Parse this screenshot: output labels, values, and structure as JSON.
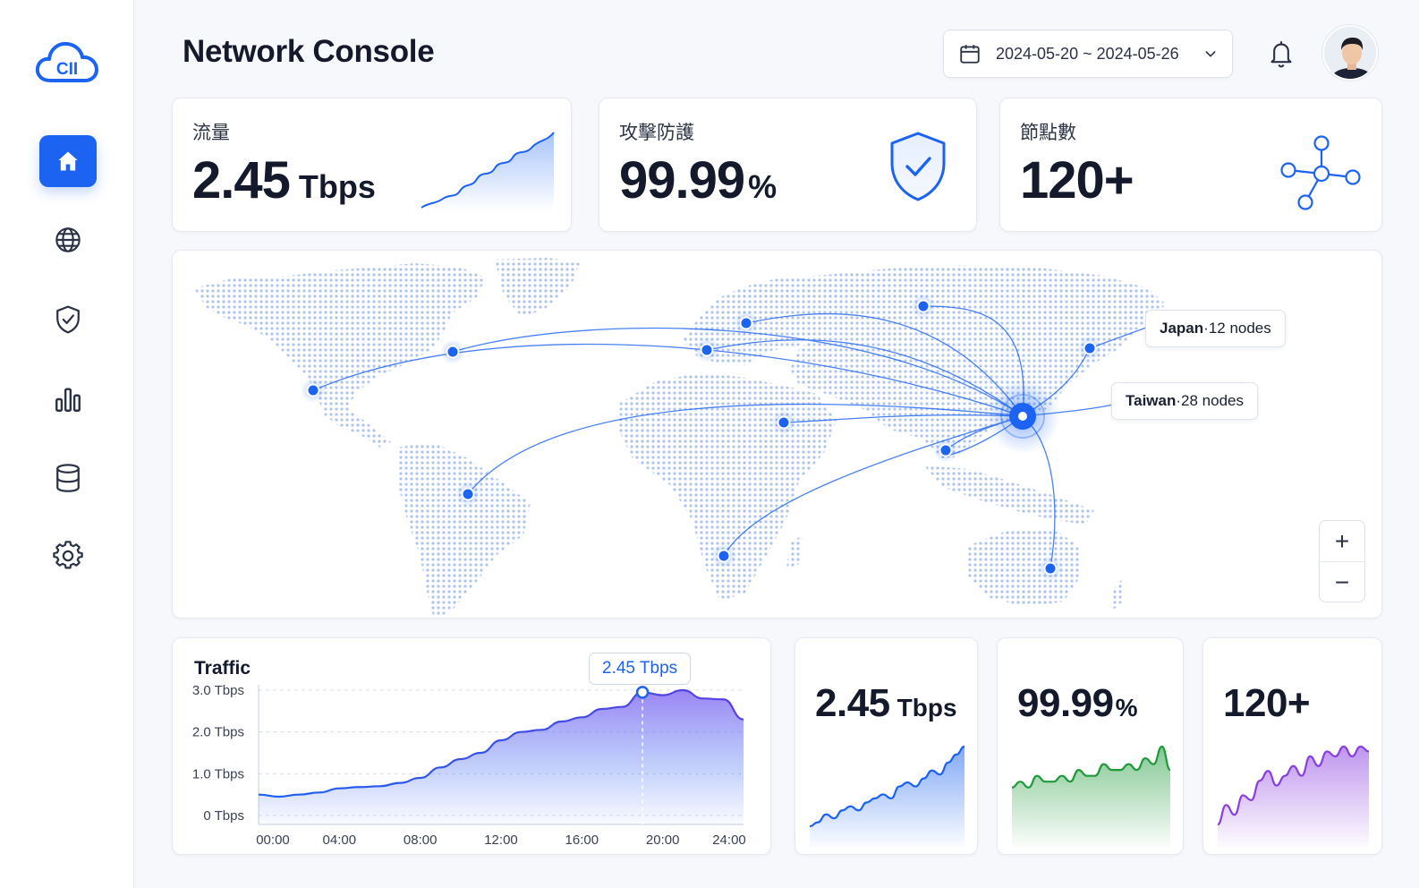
{
  "app": {
    "logo_text": "CII",
    "title": "Network Console"
  },
  "sidebar": {
    "items": [
      {
        "icon": "home-icon",
        "active": true
      },
      {
        "icon": "globe-icon",
        "active": false
      },
      {
        "icon": "shield-check-icon",
        "active": false
      },
      {
        "icon": "bar-chart-icon",
        "active": false
      },
      {
        "icon": "database-icon",
        "active": false
      },
      {
        "icon": "settings-icon",
        "active": false
      }
    ]
  },
  "header": {
    "date_range": "2024-05-20 ~ 2024-05-26",
    "calendar_icon": "calendar-icon",
    "dropdown_icon": "chevron-down-icon",
    "bell_icon": "bell-icon"
  },
  "kpis": [
    {
      "label": "流量",
      "value": "2.45",
      "unit": "Tbps",
      "icon": "trend-area-chart"
    },
    {
      "label": "攻擊防護",
      "value": "99.99",
      "unit": "%",
      "icon": "shield-check-icon"
    },
    {
      "label": "節點數",
      "value": "120+",
      "unit": "",
      "icon": "network-nodes-icon"
    }
  ],
  "map": {
    "hub": "Taiwan",
    "tags": [
      {
        "name": "Japan",
        "sep": " · ",
        "detail": "12 nodes"
      },
      {
        "name": "Taiwan",
        "sep": " · ",
        "detail": "28 nodes"
      }
    ],
    "zoom_in": "+",
    "zoom_out": "−"
  },
  "traffic": {
    "title": "Traffic",
    "tooltip": "2.45 Tbps",
    "chart_data": {
      "type": "area",
      "title": "Traffic",
      "x_labels": [
        "00:00",
        "04:00",
        "08:00",
        "12:00",
        "16:00",
        "20:00",
        "24:00"
      ],
      "y_labels": [
        "3.0 Tbps",
        "2.0 Tbps",
        "1.0 Tbps",
        "0 Tbps"
      ],
      "ylim": [
        0,
        3.0
      ],
      "x": [
        0,
        1,
        2,
        3,
        4,
        5,
        6,
        7,
        8,
        9,
        10,
        11,
        12,
        13,
        14,
        15,
        16,
        17,
        18,
        19,
        20,
        21,
        22,
        23,
        24
      ],
      "values": [
        0.5,
        0.45,
        0.5,
        0.55,
        0.65,
        0.68,
        0.7,
        0.78,
        0.9,
        1.15,
        1.35,
        1.5,
        1.8,
        2.0,
        2.05,
        2.25,
        2.35,
        2.55,
        2.6,
        2.95,
        2.88,
        3.0,
        2.8,
        2.78,
        2.3
      ],
      "highlight": {
        "x": 19,
        "label": "2.45 Tbps"
      },
      "grid": true
    }
  },
  "minis": [
    {
      "value": "2.45",
      "unit": "Tbps",
      "color": "#1b63f0",
      "values": [
        2,
        3,
        5,
        4,
        6,
        7,
        6,
        8,
        9,
        10,
        9,
        12,
        13,
        12,
        14,
        16,
        15,
        18,
        20,
        22
      ]
    },
    {
      "value": "99.99",
      "unit": "%",
      "color": "#1e9a3a",
      "values": [
        11,
        12,
        11,
        13,
        12,
        12,
        13,
        12,
        14,
        13,
        13,
        15,
        14,
        14,
        15,
        14,
        16,
        15,
        18,
        14
      ]
    },
    {
      "value": "120+",
      "unit": "",
      "color": "#8a3fe0",
      "values": [
        8,
        12,
        10,
        14,
        13,
        17,
        19,
        16,
        18,
        20,
        18,
        22,
        20,
        23,
        22,
        24,
        22,
        24,
        23
      ]
    }
  ],
  "colors": {
    "accent": "#1b63f0",
    "green": "#1e9a3a",
    "purple": "#8a3fe0"
  }
}
